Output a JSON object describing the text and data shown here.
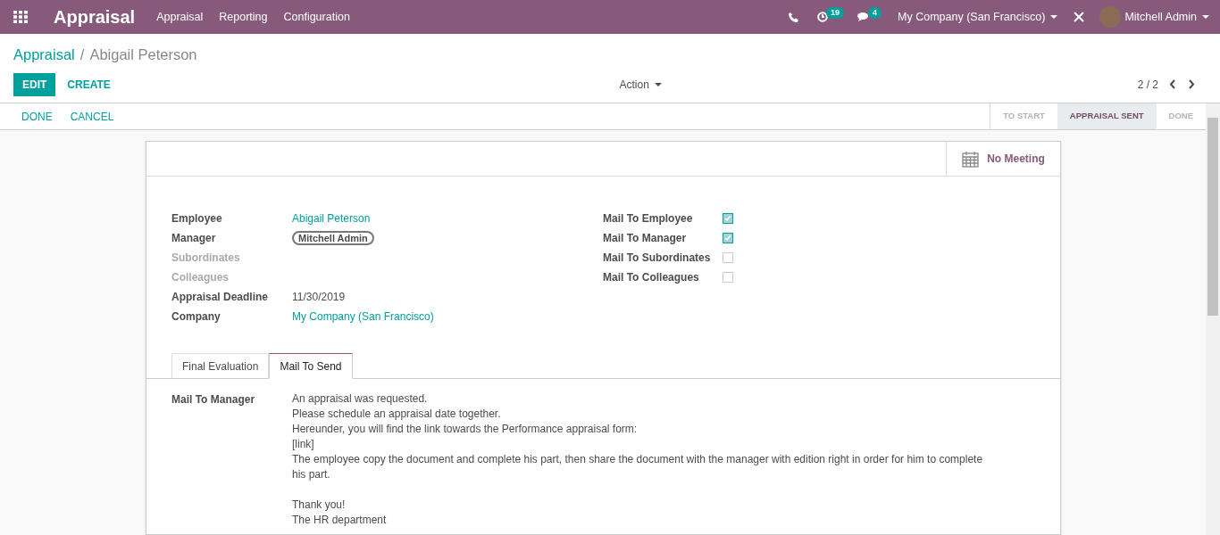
{
  "navbar": {
    "app_title": "Appraisal",
    "menu": [
      "Appraisal",
      "Reporting",
      "Configuration"
    ],
    "activity_count": "19",
    "message_count": "4",
    "company": "My Company (San Francisco)",
    "user": "Mitchell Admin"
  },
  "breadcrumb": {
    "parent": "Appraisal",
    "separator": "/",
    "current": "Abigail Peterson"
  },
  "buttons": {
    "edit": "EDIT",
    "create": "CREATE",
    "action": "Action",
    "pager": "2 / 2"
  },
  "header_buttons": [
    "DONE",
    "CANCEL"
  ],
  "stages": [
    {
      "label": "TO START",
      "selected": false
    },
    {
      "label": "APPRAISAL SENT",
      "selected": true
    },
    {
      "label": "DONE",
      "selected": false
    }
  ],
  "smart_button": "No Meeting",
  "left_fields": [
    {
      "label": "Employee",
      "value": "Abigail Peterson",
      "kind": "link",
      "muted": false
    },
    {
      "label": "Manager",
      "value": "Mitchell Admin",
      "kind": "tag",
      "muted": false
    },
    {
      "label": "Subordinates",
      "kind": "empty",
      "muted": true
    },
    {
      "label": "Colleagues",
      "kind": "empty",
      "muted": true
    },
    {
      "label": "Appraisal Deadline",
      "value": "11/30/2019",
      "kind": "text",
      "muted": false
    },
    {
      "label": "Company",
      "value": "My Company (San Francisco)",
      "kind": "link",
      "muted": false
    }
  ],
  "right_fields": [
    {
      "label": "Mail To Employee",
      "checked": true
    },
    {
      "label": "Mail To Manager",
      "checked": true
    },
    {
      "label": "Mail To Subordinates",
      "checked": false
    },
    {
      "label": "Mail To Colleagues",
      "checked": false
    }
  ],
  "tabs": [
    {
      "label": "Final Evaluation",
      "selected": false
    },
    {
      "label": "Mail To Send",
      "selected": true
    }
  ],
  "mail": {
    "label": "Mail To Manager",
    "paragraphs": [
      [
        "An appraisal was requested.",
        "Please schedule an appraisal date together.",
        "Hereunder, you will find the link towards the Performance appraisal form:",
        "[link]",
        "The employee copy the document and complete his part, then share the document with the manager with edition right in order for him to complete his part."
      ],
      [
        "Thank you!",
        "The HR department"
      ]
    ]
  }
}
